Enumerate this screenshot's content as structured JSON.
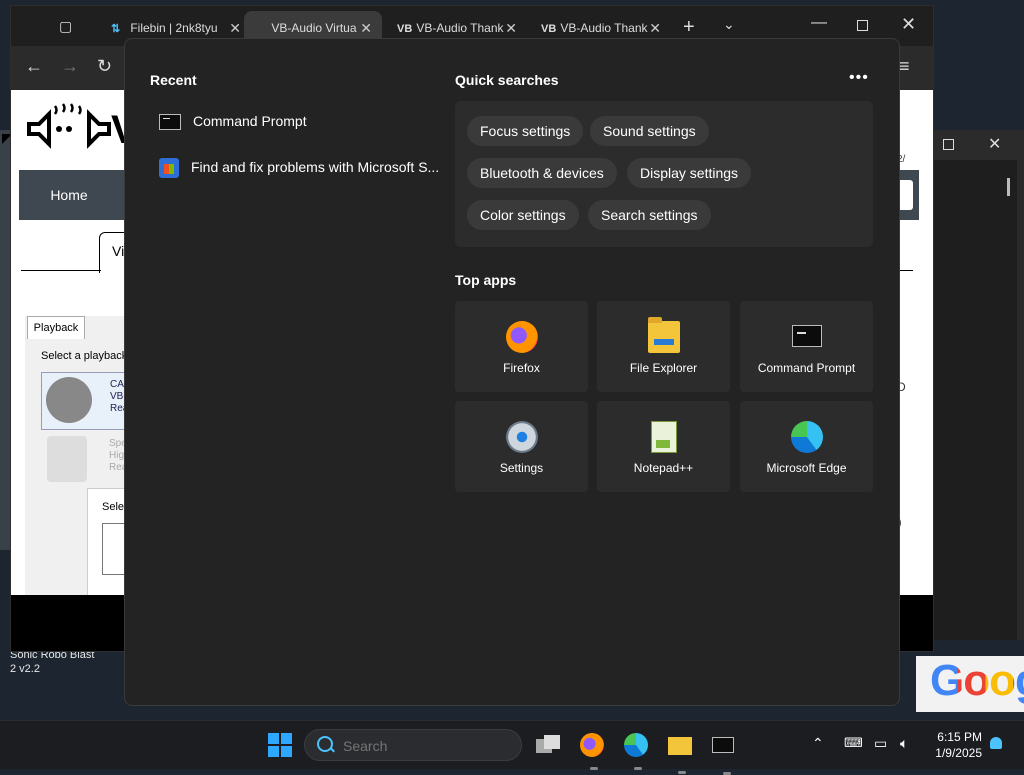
{
  "desktop": {
    "shortcut_label": "Sonic Robo Blast 2 v2.2",
    "google_text": "Goog"
  },
  "browser": {
    "tabs": [
      {
        "icon": "filebin-icon",
        "title": "Filebin | 2nk8tyu"
      },
      {
        "icon": "vb-audio-icon",
        "title": "VB-Audio Virtua",
        "active": true
      },
      {
        "icon": "vb-audio-icon",
        "title": "VB-Audio Thank"
      },
      {
        "icon": "vb-audio-icon",
        "title": "VB-Audio Thank"
      }
    ],
    "page": {
      "logo_letter": "V",
      "nav_home": "Home",
      "tab_fragment": "Vi",
      "sound_dialog": {
        "tab_label": "Playback",
        "select_text": "Select a playback",
        "device1_lines": [
          "CAB",
          "VB-",
          "Rea"
        ],
        "device2_lines": [
          "Spe",
          "Hig",
          "Rea"
        ],
        "sub_dialog_text": "Selec"
      },
      "stray_d": "D",
      "stray_4": "4)"
    }
  },
  "flyout": {
    "recent_title": "Recent",
    "recent_items": [
      {
        "icon": "command-prompt-icon",
        "label": "Command Prompt"
      },
      {
        "icon": "microsoft-store-icon",
        "label": "Find and fix problems with Microsoft S..."
      }
    ],
    "quick_title": "Quick searches",
    "quick_chips": [
      "Focus settings",
      "Sound settings",
      "Bluetooth & devices",
      "Display settings",
      "Color settings",
      "Search settings"
    ],
    "top_apps_title": "Top apps",
    "top_apps": [
      {
        "icon": "firefox-icon",
        "label": "Firefox"
      },
      {
        "icon": "file-explorer-icon",
        "label": "File Explorer"
      },
      {
        "icon": "command-prompt-icon",
        "label": "Command Prompt"
      },
      {
        "icon": "settings-icon",
        "label": "Settings"
      },
      {
        "icon": "notepad-plus-plus-icon",
        "label": "Notepad++"
      },
      {
        "icon": "microsoft-edge-icon",
        "label": "Microsoft Edge"
      }
    ]
  },
  "taskbar": {
    "search_placeholder": "Search",
    "time": "6:15 PM",
    "date": "1/9/2025"
  },
  "colors": {
    "accent": "#4cc2ff",
    "start_blue": "#2ea8ff",
    "flyout_bg": "#232323",
    "tile_bg": "#2c2c2c"
  }
}
